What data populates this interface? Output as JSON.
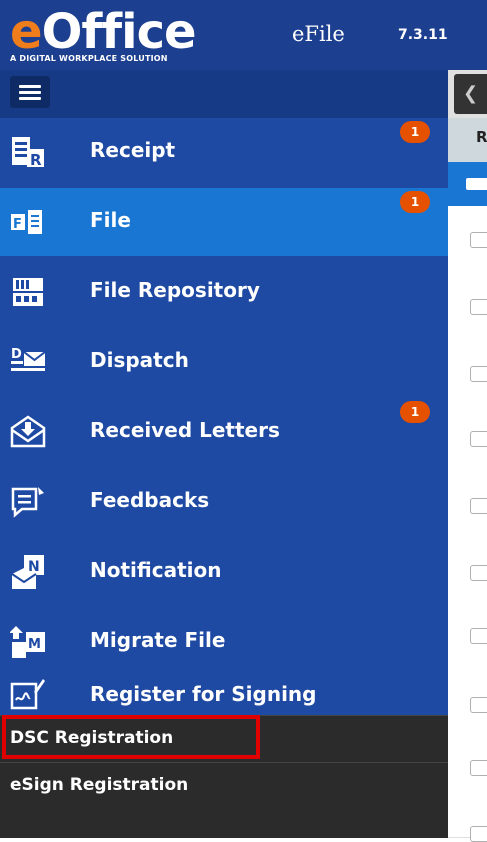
{
  "header": {
    "logo_text_e": "e",
    "logo_text_rest": "Office",
    "logo_tagline": "A DIGITAL WORKPLACE SOLUTION",
    "app_name": "eFile",
    "version": "7.3.11"
  },
  "menu": {
    "items": [
      {
        "label": "Receipt",
        "icon": "receipt-icon",
        "badge": "1",
        "active": false
      },
      {
        "label": "File",
        "icon": "file-icon",
        "badge": "1",
        "active": true
      },
      {
        "label": "File Repository",
        "icon": "file-repository-icon",
        "badge": null,
        "active": false
      },
      {
        "label": "Dispatch",
        "icon": "dispatch-icon",
        "badge": null,
        "active": false
      },
      {
        "label": "Received Letters",
        "icon": "received-letters-icon",
        "badge": "1",
        "active": false
      },
      {
        "label": "Feedbacks",
        "icon": "feedback-icon",
        "badge": null,
        "active": false
      },
      {
        "label": "Notification",
        "icon": "notification-icon",
        "badge": null,
        "active": false
      },
      {
        "label": "Migrate File",
        "icon": "migrate-file-icon",
        "badge": null,
        "active": false
      },
      {
        "label": "Register for Signing",
        "icon": "register-signing-icon",
        "badge": null,
        "active": false
      }
    ],
    "sub_items": [
      {
        "label": "DSC Registration",
        "highlighted": true
      },
      {
        "label": "eSign Registration",
        "highlighted": false
      }
    ]
  },
  "right_panel": {
    "column_header_partial": "R",
    "collapse_icon": "chevron-left-icon"
  },
  "colors": {
    "topbar": "#1c3f8f",
    "sidebar": "#1f4aa3",
    "active": "#1976d2",
    "badge": "#e65100",
    "logo_e": "#f07d1c",
    "highlight": "#e00000"
  }
}
